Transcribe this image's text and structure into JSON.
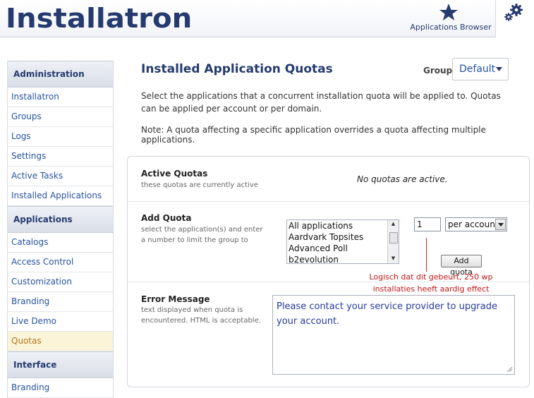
{
  "header": {
    "logo": "Installatron",
    "apps_browser_label": "Applications Browser",
    "apps_browser_icon": "star-icon",
    "settings_icon": "gears-icon"
  },
  "sidebar": {
    "sections": [
      {
        "title": "Administration",
        "items": [
          "Installatron",
          "Groups",
          "Logs",
          "Settings",
          "Active Tasks",
          "Installed Applications"
        ]
      },
      {
        "title": "Applications",
        "items": [
          "Catalogs",
          "Access Control",
          "Customization",
          "Branding",
          "Live Demo",
          "Quotas"
        ]
      },
      {
        "title": "Interface",
        "items": [
          "Branding"
        ]
      }
    ],
    "active_item": "Quotas"
  },
  "main": {
    "title": "Installed Application Quotas",
    "group_label": "Group:",
    "group_value": "Default",
    "description": "Select the applications that a concurrent installation quota will be applied to. Quotas can be applied per account or per domain.",
    "note": "Note: A quota affecting a specific application overrides a quota affecting multiple applications.",
    "active_quotas": {
      "title": "Active Quotas",
      "subtitle": "these quotas are currently active",
      "empty_text": "No quotas are active."
    },
    "add_quota": {
      "title": "Add Quota",
      "subtitle": "select the application(s) and enter a number to limit the group to",
      "apps": [
        "All applications",
        "Aardvark Topsites",
        "Advanced Poll",
        "b2evolution"
      ],
      "quantity": "1",
      "per_value": "per account",
      "button": "Add quota",
      "annotation_line1": "Logisch dat dit gebeurt, 250 wp",
      "annotation_line2": "installaties heeft aardig effect"
    },
    "error_message": {
      "title": "Error Message",
      "subtitle": "text displayed when quota is encountered. HTML is acceptable.",
      "value": "Please contact your service provider to upgrade your account."
    }
  },
  "colors": {
    "brand": "#253a6e",
    "link": "#2553a3",
    "active_bg": "#fbf4d8",
    "annotation": "#c41515"
  }
}
